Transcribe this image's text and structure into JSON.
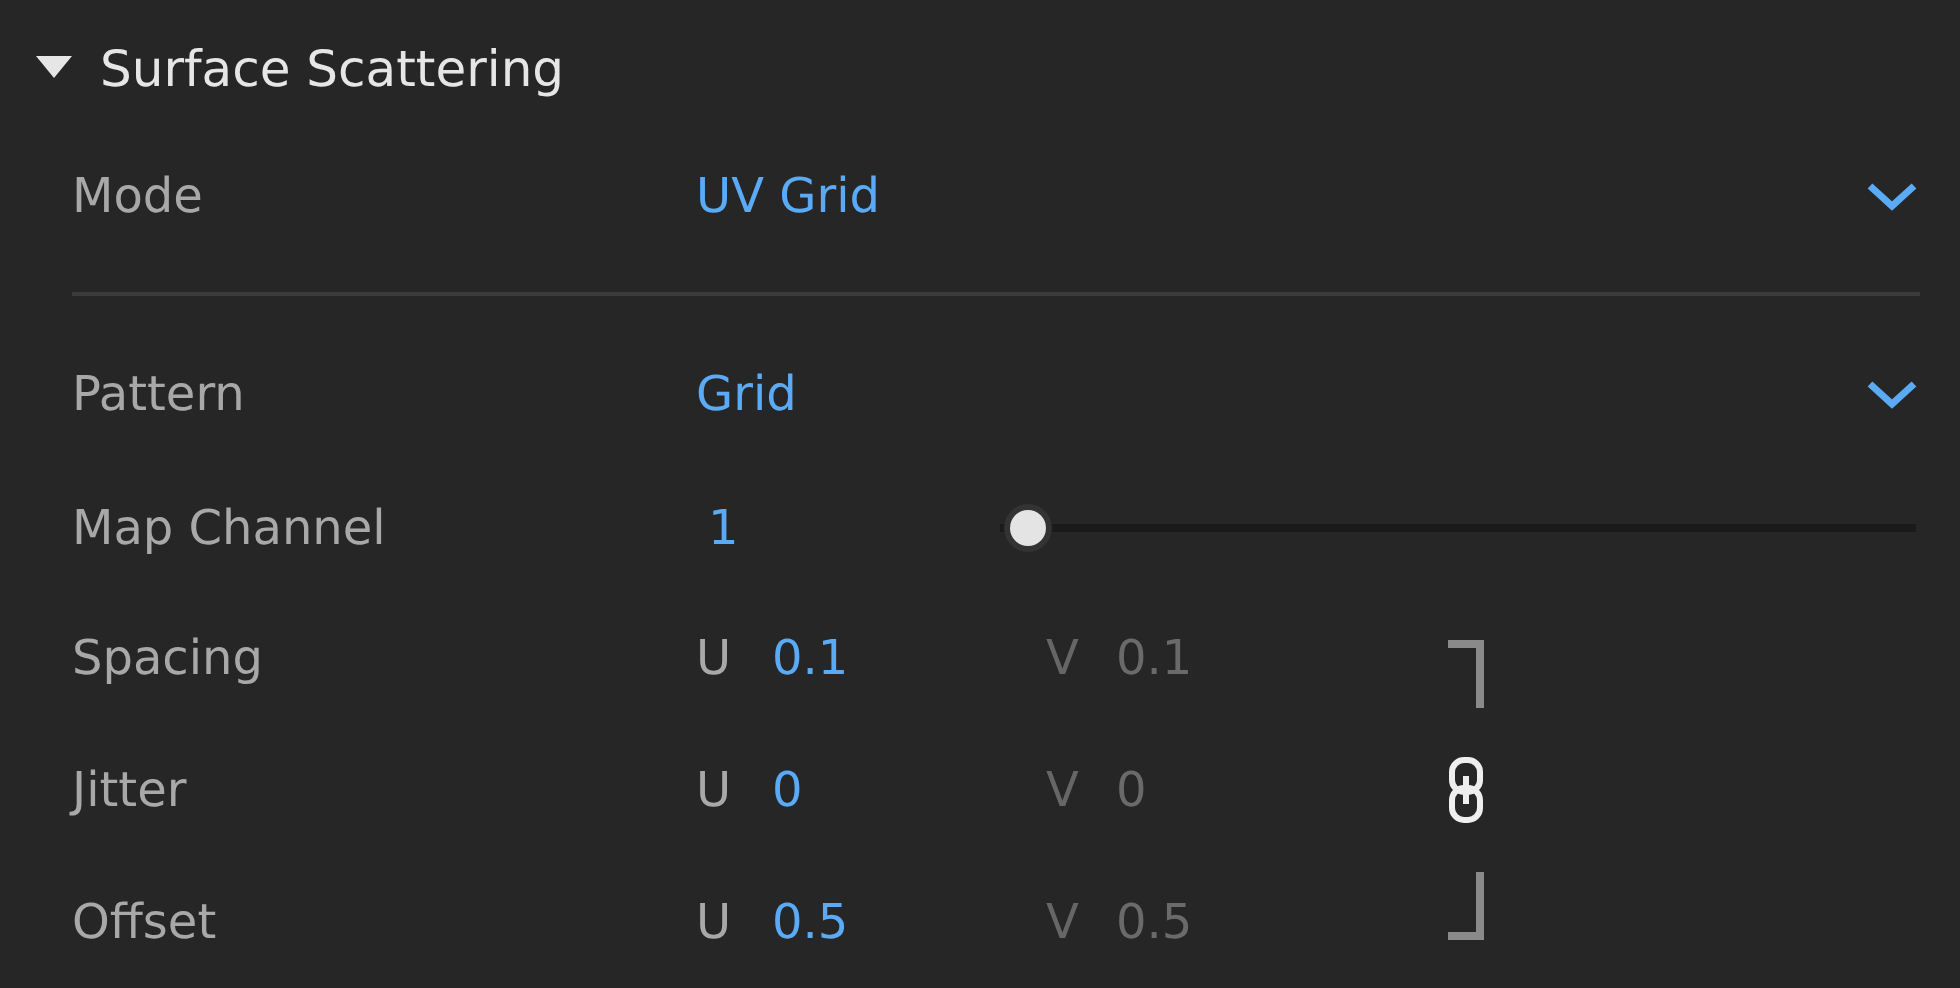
{
  "section": {
    "title": "Surface Scattering",
    "expanded": true
  },
  "mode": {
    "label": "Mode",
    "value": "UV Grid"
  },
  "pattern": {
    "label": "Pattern",
    "value": "Grid"
  },
  "map_channel": {
    "label": "Map Channel",
    "value": "1",
    "level": 0.03
  },
  "uv_rows": [
    {
      "label": "Spacing",
      "u_label": "U",
      "u_value": "0.1",
      "v_label": "V",
      "v_value": "0.1"
    },
    {
      "label": "Jitter",
      "u_label": "U",
      "u_value": "0",
      "v_label": "V",
      "v_value": "0"
    },
    {
      "label": "Offset",
      "u_label": "U",
      "u_value": "0.5",
      "v_label": "V",
      "v_value": "0.5"
    }
  ],
  "uv_linked": true
}
